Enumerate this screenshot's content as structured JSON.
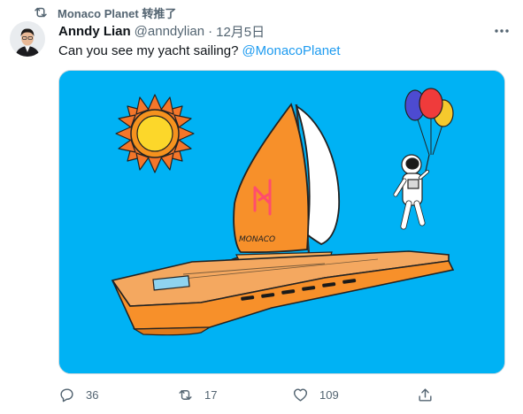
{
  "retweet": {
    "icon": "retweet-icon",
    "text": "Monaco Planet 转推了"
  },
  "tweet": {
    "author_name": "Anndy Lian",
    "handle": "@anndylian",
    "separator": "·",
    "date": "12月5日",
    "text": "Can you see my yacht sailing?",
    "mention": "@MonacoPlanet",
    "more_icon": "more-icon"
  },
  "media": {
    "background": "#00b2f4",
    "sail_lettering": "MONACO"
  },
  "actions": {
    "reply": {
      "icon": "reply-icon",
      "count": "36"
    },
    "retweet": {
      "icon": "retweet-icon",
      "count": "17"
    },
    "like": {
      "icon": "heart-icon",
      "count": "109"
    },
    "share": {
      "icon": "share-icon"
    }
  },
  "colors": {
    "link": "#1d9bf0",
    "muted": "#536471",
    "text": "#0f1419",
    "sky": "#00b2f4",
    "hull": "#f7902a"
  }
}
